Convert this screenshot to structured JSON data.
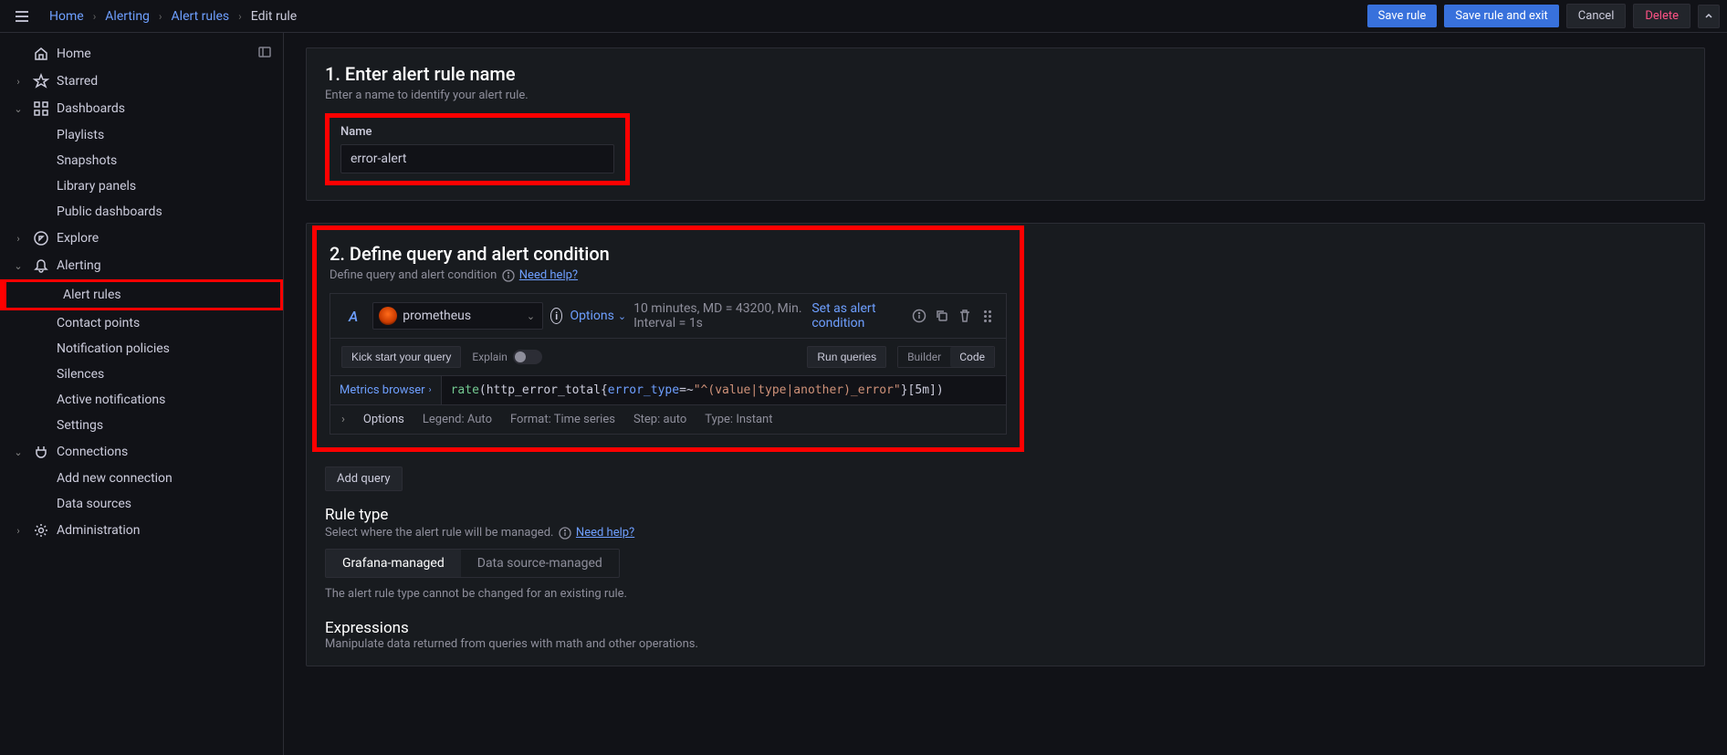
{
  "breadcrumb": {
    "home": "Home",
    "alerting": "Alerting",
    "alert_rules": "Alert rules",
    "current": "Edit rule"
  },
  "actions": {
    "save": "Save rule",
    "save_exit": "Save rule and exit",
    "cancel": "Cancel",
    "delete": "Delete"
  },
  "sidebar": {
    "items": [
      {
        "label": "Home",
        "icon": "home",
        "level": 0,
        "chevron": "",
        "dock": true
      },
      {
        "label": "Starred",
        "icon": "star",
        "level": 0,
        "chevron": "right"
      },
      {
        "label": "Dashboards",
        "icon": "grid",
        "level": 0,
        "chevron": "down"
      },
      {
        "label": "Playlists",
        "level": 1
      },
      {
        "label": "Snapshots",
        "level": 1
      },
      {
        "label": "Library panels",
        "level": 1
      },
      {
        "label": "Public dashboards",
        "level": 1
      },
      {
        "label": "Explore",
        "icon": "compass",
        "level": 0,
        "chevron": "right"
      },
      {
        "label": "Alerting",
        "icon": "bell",
        "level": 0,
        "chevron": "down"
      },
      {
        "label": "Alert rules",
        "level": 1,
        "highlighted": true
      },
      {
        "label": "Contact points",
        "level": 1
      },
      {
        "label": "Notification policies",
        "level": 1
      },
      {
        "label": "Silences",
        "level": 1
      },
      {
        "label": "Active notifications",
        "level": 1
      },
      {
        "label": "Settings",
        "level": 1
      },
      {
        "label": "Connections",
        "icon": "plug",
        "level": 0,
        "chevron": "down"
      },
      {
        "label": "Add new connection",
        "level": 1
      },
      {
        "label": "Data sources",
        "level": 1
      },
      {
        "label": "Administration",
        "icon": "gear",
        "level": 0,
        "chevron": "right"
      }
    ]
  },
  "section1": {
    "title": "1. Enter alert rule name",
    "subtitle": "Enter a name to identify your alert rule.",
    "name_label": "Name",
    "name_value": "error-alert"
  },
  "section2": {
    "title": "2. Define query and alert condition",
    "subtitle": "Define query and alert condition",
    "need_help": "Need help?",
    "query": {
      "id": "A",
      "datasource": "prometheus",
      "options_label": "Options",
      "meta": "10 minutes, MD = 43200, Min. Interval = 1s",
      "set_condition": "Set as alert condition",
      "kick_start": "Kick start your query",
      "explain": "Explain",
      "run_queries": "Run queries",
      "builder": "Builder",
      "code": "Code",
      "metrics_browser": "Metrics browser",
      "expression": "rate(http_error_total{error_type=~\"^(value|type|another)_error\"}[5m])",
      "footer_options": "Options",
      "legend_label": "Legend:",
      "legend_value": "Auto",
      "format_label": "Format:",
      "format_value": "Time series",
      "step_label": "Step:",
      "step_value": "auto",
      "type_label": "Type:",
      "type_value": "Instant"
    },
    "add_query": "Add query",
    "rule_type": {
      "title": "Rule type",
      "subtitle": "Select where the alert rule will be managed.",
      "need_help": "Need help?",
      "grafana": "Grafana-managed",
      "datasource": "Data source-managed",
      "note": "The alert rule type cannot be changed for an existing rule."
    },
    "expressions": {
      "title": "Expressions",
      "subtitle": "Manipulate data returned from queries with math and other operations."
    }
  }
}
